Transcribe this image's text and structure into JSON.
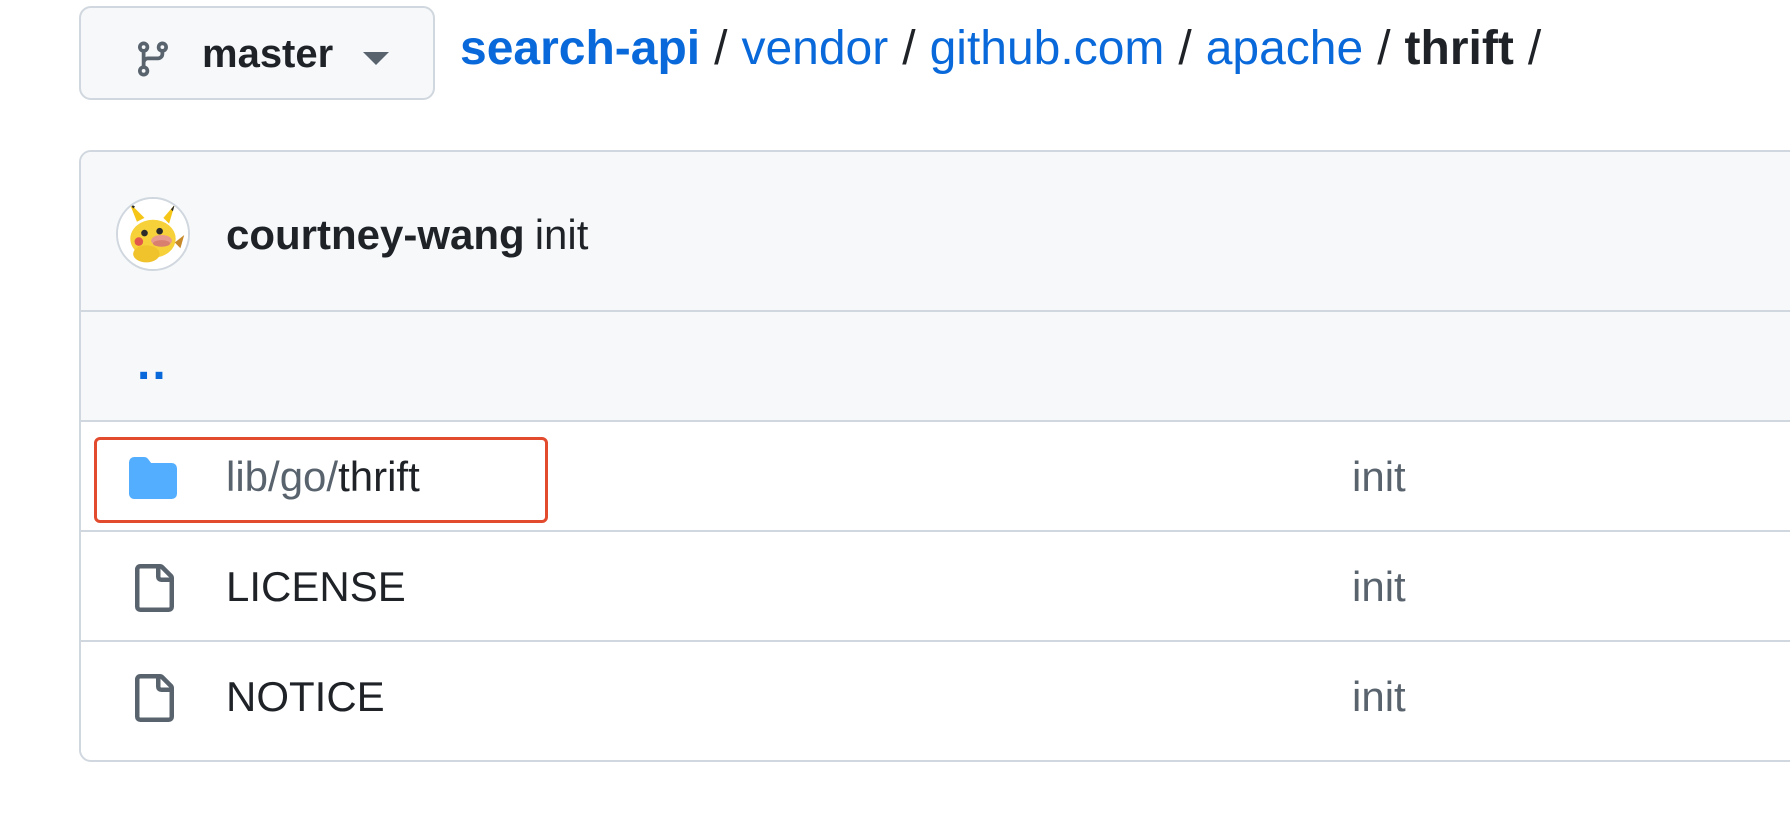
{
  "branch": {
    "name": "master",
    "icon": "git-branch-icon",
    "dropdown_icon": "triangle-down-icon"
  },
  "breadcrumb": {
    "repo": "search-api",
    "segments": [
      "vendor",
      "github.com",
      "apache"
    ],
    "current": "thrift",
    "separator": "/"
  },
  "commit": {
    "author": "courtney-wang",
    "message": "init",
    "avatar": "pikachu-avatar"
  },
  "files": {
    "parent_link": "..",
    "rows": [
      {
        "type": "directory",
        "icon": "folder-icon",
        "path_prefix": "lib/go/",
        "name": "thrift",
        "message": "init",
        "highlighted": true
      },
      {
        "type": "file",
        "icon": "file-icon",
        "path_prefix": "",
        "name": "LICENSE",
        "message": "init"
      },
      {
        "type": "file",
        "icon": "file-icon",
        "path_prefix": "",
        "name": "NOTICE",
        "message": "init"
      }
    ]
  },
  "colors": {
    "link": "#0969da",
    "text": "#1f2328",
    "muted": "#59636e",
    "border": "#d0d7de",
    "header_bg": "#f6f8fa",
    "folder": "#54aeff",
    "highlight": "#e34b2e"
  }
}
